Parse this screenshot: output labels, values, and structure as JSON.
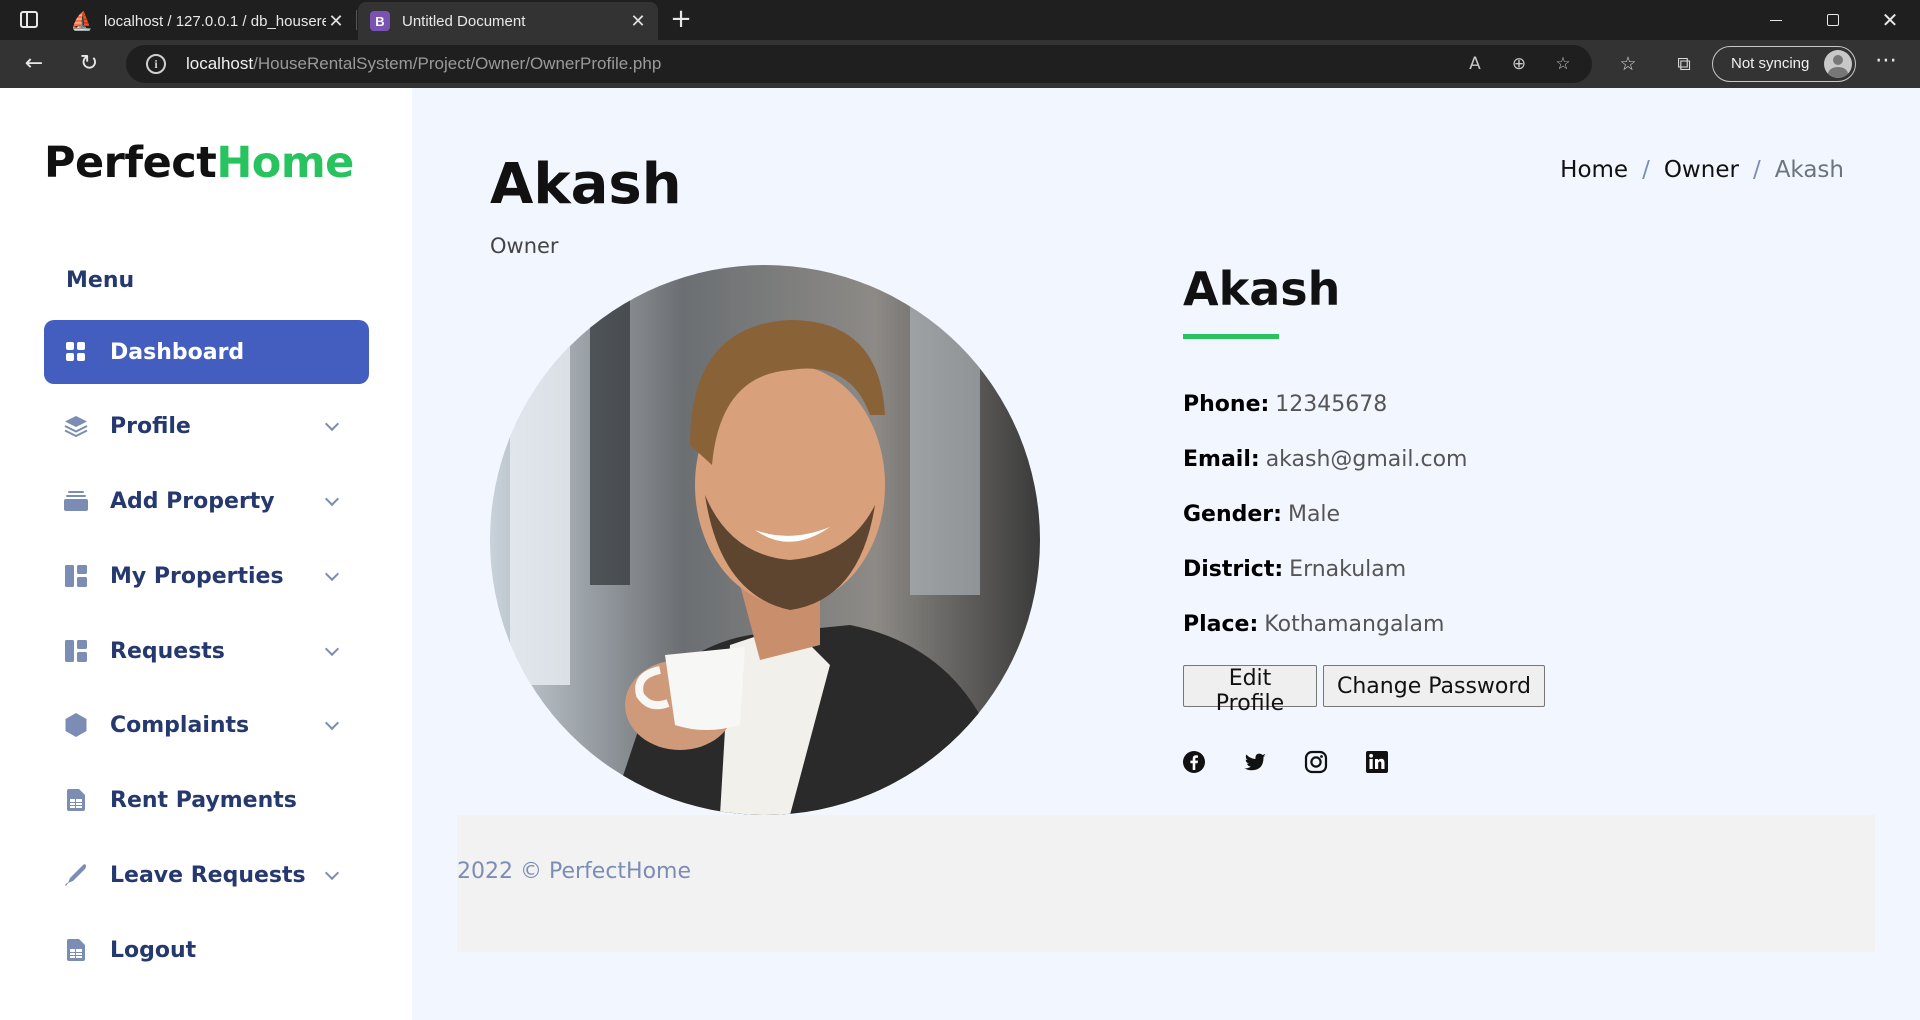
{
  "browser": {
    "tabs": [
      {
        "title": "localhost / 127.0.0.1 / db_houserental",
        "favicon": "phpmyadmin-icon"
      },
      {
        "title": "Untitled Document",
        "favicon": "bootstrap-icon",
        "favicon_letter": "B"
      }
    ],
    "url_host": "localhost",
    "url_path": "/HouseRentalSystem/Project/Owner/OwnerProfile.php",
    "sync_label": "Not syncing"
  },
  "brand": {
    "part1": "Perfect",
    "part2": "Home",
    "accent": "#28c35f"
  },
  "sidebar": {
    "menu_title": "Menu",
    "items": [
      {
        "label": "Dashboard",
        "icon": "grid-icon",
        "active": true,
        "has_submenu": false
      },
      {
        "label": "Profile",
        "icon": "stack-icon",
        "active": false,
        "has_submenu": true
      },
      {
        "label": "Add Property",
        "icon": "collection-icon",
        "active": false,
        "has_submenu": true
      },
      {
        "label": "My Properties",
        "icon": "layout-icon",
        "active": false,
        "has_submenu": true
      },
      {
        "label": "Requests",
        "icon": "layout-icon",
        "active": false,
        "has_submenu": true
      },
      {
        "label": "Complaints",
        "icon": "hexagon-icon",
        "active": false,
        "has_submenu": true
      },
      {
        "label": "Rent Payments",
        "icon": "spreadsheet-icon",
        "active": false,
        "has_submenu": false
      },
      {
        "label": "Leave Requests",
        "icon": "pen-icon",
        "active": false,
        "has_submenu": true
      },
      {
        "label": "Logout",
        "icon": "spreadsheet-icon",
        "active": false,
        "has_submenu": false
      }
    ],
    "active_color": "#435ebe"
  },
  "header": {
    "title": "Akash",
    "subtitle": "Owner",
    "breadcrumb": [
      "Home",
      "Owner",
      "Akash"
    ]
  },
  "profile": {
    "name": "Akash",
    "fields": [
      {
        "label": "Phone:",
        "value": "12345678"
      },
      {
        "label": "Email:",
        "value": "akash@gmail.com"
      },
      {
        "label": "Gender:",
        "value": "Male"
      },
      {
        "label": "District:",
        "value": "Ernakulam"
      },
      {
        "label": "Place:",
        "value": "Kothamangalam"
      }
    ],
    "buttons": {
      "edit": "Edit Profile",
      "change_password": "Change Password"
    },
    "social": [
      "facebook-icon",
      "twitter-icon",
      "instagram-icon",
      "linkedin-icon"
    ]
  },
  "footer": {
    "text": "2022 © PerfectHome"
  }
}
